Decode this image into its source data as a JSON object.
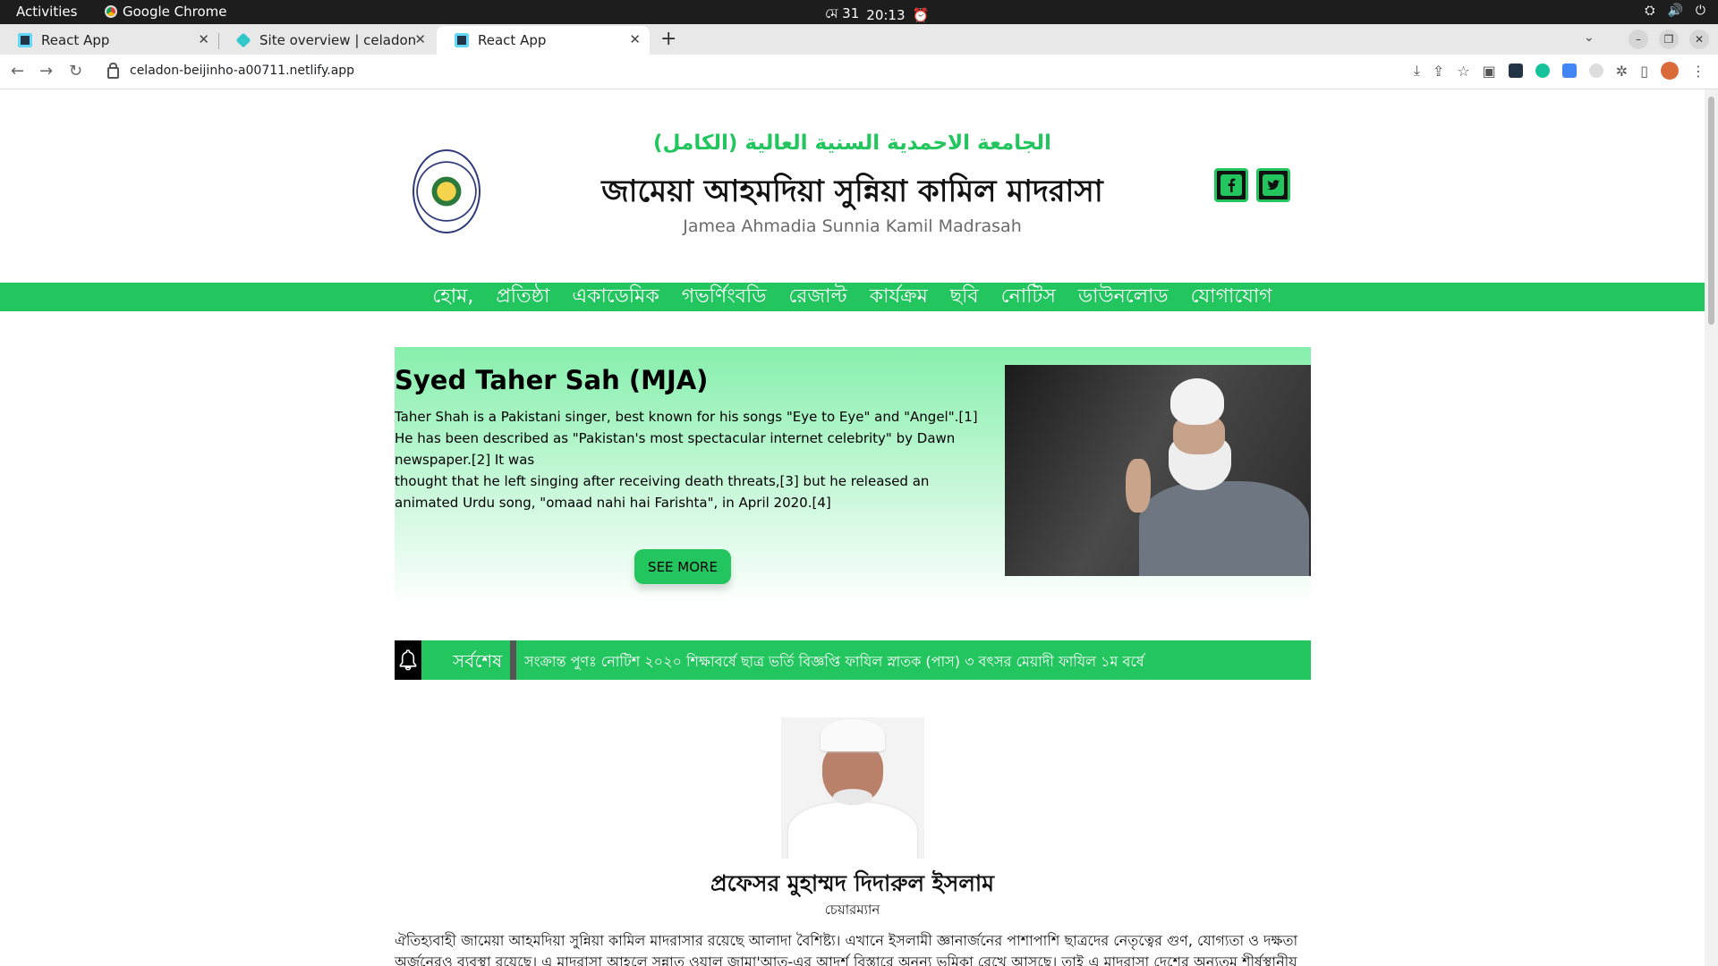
{
  "os": {
    "activities": "Activities",
    "app_name": "Google Chrome",
    "date": "মে 31",
    "time": "20:13"
  },
  "browser": {
    "tabs": [
      {
        "title": "React App",
        "active": false
      },
      {
        "title": "Site overview | celadon-be",
        "active": false
      },
      {
        "title": "React App",
        "active": true
      }
    ],
    "url": "celadon-beijinho-a00711.netlify.app"
  },
  "site": {
    "arabic_title": "الجامعة الاحمدية السنية العالية (الكامل)",
    "bangla_title": "জামেয়া আহমদিয়া সুন্নিয়া কামিল মাদরাসা",
    "english_title": "Jamea Ahmadia Sunnia Kamil Madrasah",
    "nav": [
      "হোম,",
      "প্রতিষ্ঠা",
      "একাডেমিক",
      "গভর্ণিংবডি",
      "রেজাল্ট",
      "কার্যক্রম",
      "ছবি",
      "নোটিস",
      "ডাউনলোড",
      "যোগাযোগ"
    ]
  },
  "hero": {
    "title": "Syed Taher Sah (MJA)",
    "lines": [
      "Taher Shah is a Pakistani singer, best known for his songs \"Eye to Eye\" and \"Angel\".[1]",
      "He has been described as \"Pakistan's most spectacular internet celebrity\" by Dawn newspaper.[2] It was",
      "thought that he left singing after receiving death threats,[3] but he released an animated Urdu song, \"omaad nahi hai Farishta\", in April 2020.[4]"
    ],
    "button": "SEE MORE"
  },
  "ticker": {
    "label": "সর্বশেষ",
    "text": "সংক্রান্ত পুণঃ নোটিশ ২০২০ শিক্ষাবর্ষে ছাত্র ভর্তি বিজ্ঞপ্তি ফাযিল স্নাতক (পাস) ৩ বৎসর মেয়াদী ফাযিল ১ম বর্ষে"
  },
  "chairman": {
    "name": "প্রফেসর মুহাম্মদ দিদারুল ইসলাম",
    "role": "চেয়ারম্যান",
    "text": "ঐতিহ্যবাহী জামেয়া আহমদিয়া সুন্নিয়া কামিল মাদরাসার রয়েছে আলাদা বৈশিষ্ট্য। এখানে ইসলামী জ্ঞানার্জনের পাশাপাশি ছাত্রদের নেতৃত্বের গুণ, যোগ্যতা ও দক্ষতা অর্জনেরও ব্যবস্থা রয়েছে। এ মাদরাসা আহলে সুন্নাত ওয়াল জামা'আত-এর আদর্শ বিস্তারে অনন্য ভূমিকা রেখে আসছে। তাই এ মাদরাসা দেশের অন্যতম শীর্ষস্থানীয় দ্বীনী"
  },
  "colors": {
    "accent": "#22c55e",
    "hero_gradient_top": "#86efac"
  }
}
